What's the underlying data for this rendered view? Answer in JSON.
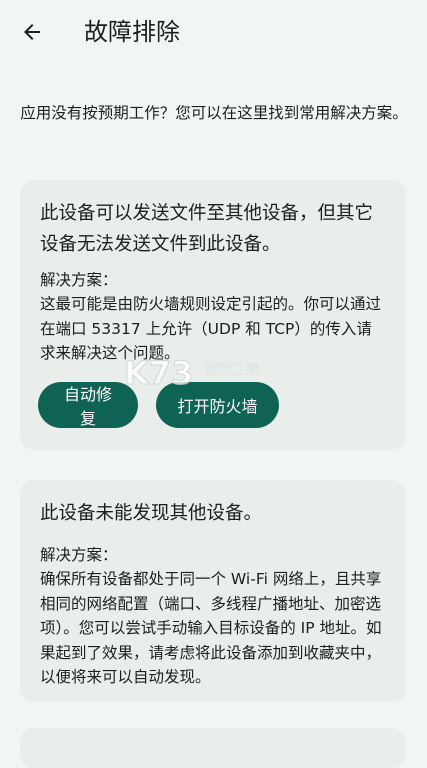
{
  "header": {
    "title": "故障排除"
  },
  "intro": "应用没有按预期工作？您可以在这里找到常用解决方案。",
  "cards": [
    {
      "title": "此设备可以发送文件至其他设备，但其它设备无法发送文件到此设备。",
      "solution_label": "解决方案：",
      "solution_text": "这最可能是由防火墙规则设定引起的。你可以通过在端口 53317 上允许（UDP 和 TCP）的传入请求来解决这个问题。",
      "buttons": {
        "autofix": "自动修复",
        "firewall": "打开防火墙"
      }
    },
    {
      "title": "此设备未能发现其他设备。",
      "solution_label": "解决方案：",
      "solution_text": "确保所有设备都处于同一个 Wi-Fi 网络上，且共享相同的网络配置（端口、多线程广播地址、加密选项）。您可以尝试手动输入目标设备的 IP 地址。如果起到了效果，请考虑将此设备添加到收藏夹中，以便将来可以自动发现。"
    }
  ],
  "watermark": {
    "logo_text": "K73",
    "site_text": "游戏之家"
  },
  "colors": {
    "background": "#f2f6f3",
    "card": "#e9eeea",
    "primary_button": "#0f6355",
    "text": "#1b1f1d"
  }
}
